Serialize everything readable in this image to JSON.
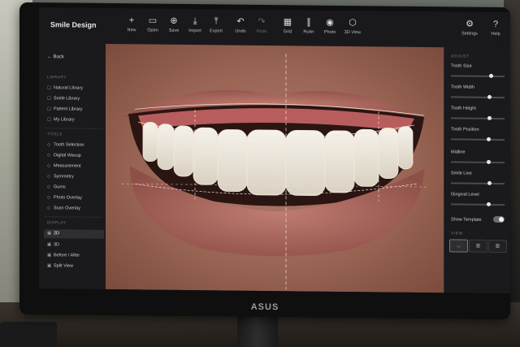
{
  "app": {
    "title": "Smile Design"
  },
  "toolbar": [
    {
      "id": "new",
      "label": "New",
      "icon": "+"
    },
    {
      "id": "open",
      "label": "Open",
      "icon": "▭"
    },
    {
      "id": "save",
      "label": "Save",
      "icon": "⊕"
    },
    {
      "id": "import",
      "label": "Import",
      "icon": "⤓"
    },
    {
      "id": "export",
      "label": "Export",
      "icon": "⤒"
    },
    {
      "id": "undo",
      "label": "Undo",
      "icon": "↶"
    },
    {
      "id": "redo",
      "label": "Redo",
      "icon": "↷"
    },
    {
      "id": "grid",
      "label": "Grid",
      "icon": "▦"
    },
    {
      "id": "ruler",
      "label": "Ruler",
      "icon": "∥"
    },
    {
      "id": "photo",
      "label": "Photo",
      "icon": "◉"
    },
    {
      "id": "3dview",
      "label": "3D View",
      "icon": "⬡"
    },
    {
      "id": "settings",
      "label": "Settings",
      "icon": "⚙"
    },
    {
      "id": "help",
      "label": "Help",
      "icon": "?"
    }
  ],
  "sidebar": {
    "back": "Back",
    "library_header": "LIBRARY",
    "library": [
      "Natural Library",
      "Smile Library",
      "Patient Library",
      "My Library"
    ],
    "tools_header": "TOOLS",
    "tools": [
      "Tooth Selection",
      "Digital Waxup",
      "Measurement",
      "Symmetry",
      "Gums",
      "Photo Overlay",
      "Scan Overlay"
    ],
    "display_header": "DISPLAY",
    "display": [
      "2D",
      "3D",
      "Before / After",
      "Split View"
    ]
  },
  "adjust": {
    "header": "ADJUST",
    "sliders": [
      {
        "label": "Tooth Size",
        "value": 0.75
      },
      {
        "label": "Tooth Width",
        "value": 0.72
      },
      {
        "label": "Tooth Height",
        "value": 0.72
      },
      {
        "label": "Tooth Position",
        "value": 0.7
      },
      {
        "label": "Midline",
        "value": 0.7
      },
      {
        "label": "Smile Line",
        "value": 0.72
      },
      {
        "label": "Gingival Level",
        "value": 0.7
      }
    ],
    "show_template": "Show Template",
    "view_header": "VIEW"
  },
  "monitor": {
    "brand": "ASUS"
  },
  "colors": {
    "accent": "#e6e6e6",
    "panel": "#1a1a1d",
    "guide": "#f1e6d8"
  }
}
